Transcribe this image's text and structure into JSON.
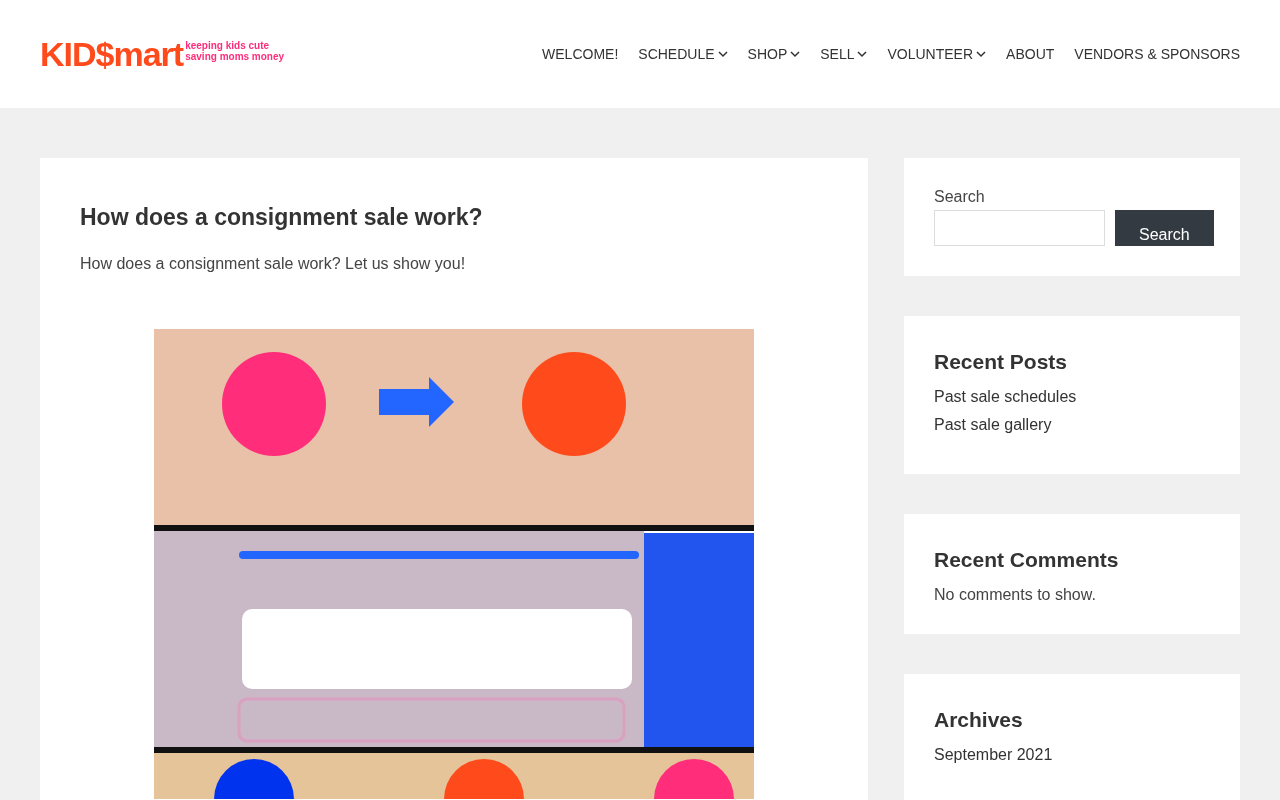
{
  "logo": {
    "name": "KID$mart",
    "tagline_1": "keeping kids cute",
    "tagline_2": "saving moms money"
  },
  "nav": [
    {
      "label": "WELCOME!",
      "has_menu": false
    },
    {
      "label": "SCHEDULE",
      "has_menu": true
    },
    {
      "label": "SHOP",
      "has_menu": true
    },
    {
      "label": "SELL",
      "has_menu": true
    },
    {
      "label": "VOLUNTEER",
      "has_menu": true
    },
    {
      "label": "ABOUT",
      "has_menu": false
    },
    {
      "label": "VENDORS & SPONSORS",
      "has_menu": false
    }
  ],
  "post": {
    "title": "How does a consignment sale work?",
    "intro": "How does a consignment sale work? Let us show you!"
  },
  "sidebar": {
    "search": {
      "label": "Search",
      "button": "Search"
    },
    "widgets": [
      {
        "title": "Recent Posts",
        "links": [
          "Past sale schedules",
          "Past sale gallery"
        ]
      },
      {
        "title": "Recent Comments",
        "text": "No comments to show."
      },
      {
        "title": "Archives",
        "links": [
          "September 2021"
        ]
      }
    ]
  }
}
